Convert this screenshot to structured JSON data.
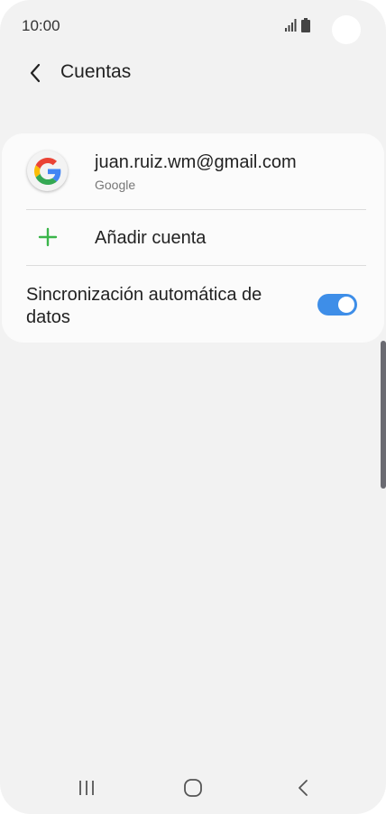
{
  "status_bar": {
    "time": "10:00",
    "icons": [
      "signal-icon",
      "battery-icon"
    ]
  },
  "header": {
    "back_icon": "back-arrow-icon",
    "title": "Cuentas"
  },
  "accounts": [
    {
      "email": "juan.ruiz.wm@gmail.com",
      "type": "Google",
      "icon": "google-icon"
    }
  ],
  "add_account": {
    "label": "Añadir cuenta",
    "icon": "plus-icon"
  },
  "auto_sync": {
    "label": "Sincronización automática de datos",
    "enabled": true
  },
  "navigation": {
    "icons": [
      "recent-apps-icon",
      "home-icon",
      "back-icon"
    ]
  },
  "colors": {
    "background": "#f2f2f2",
    "card": "#fbfbfb",
    "accent": "#3e8ee8",
    "add_icon": "#3bb54a",
    "google_blue": "#4285F4",
    "google_red": "#EA4335",
    "google_yellow": "#FBBC05",
    "google_green": "#34A853"
  }
}
